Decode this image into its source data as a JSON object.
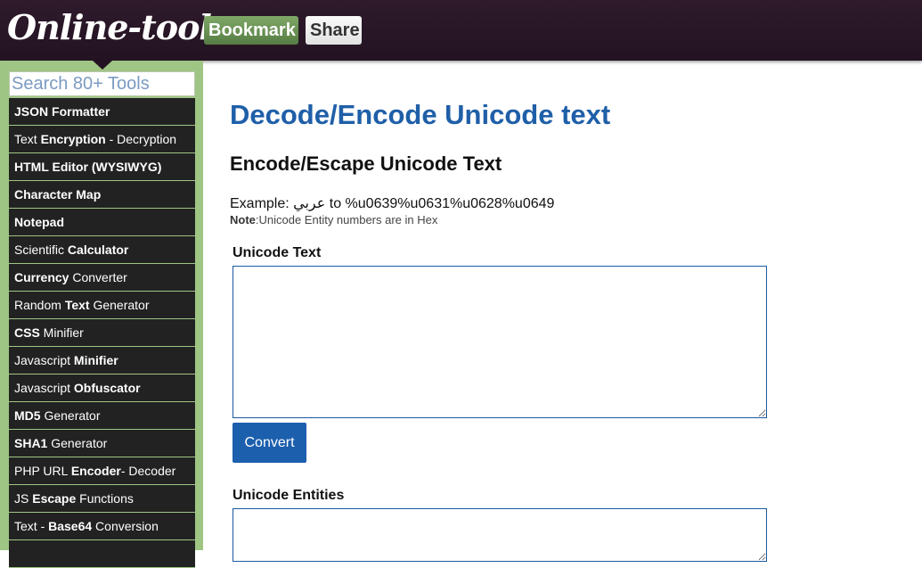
{
  "header": {
    "logo": "Online-toolz",
    "bookmark_label": "Bookmark",
    "share_label": "Share",
    "colors": {
      "background": "#2e1a2b",
      "bookmark": "#6b9556",
      "share": "#eeeeee"
    }
  },
  "sidebar": {
    "search_placeholder": "Search 80+ Tools",
    "items": [
      {
        "pre": "",
        "bold": "JSON Formatter",
        "post": ""
      },
      {
        "pre": "Text ",
        "bold": "Encryption",
        "post": " - Decryption"
      },
      {
        "pre": "",
        "bold": "HTML Editor (WYSIWYG)",
        "post": ""
      },
      {
        "pre": "",
        "bold": "Character Map",
        "post": ""
      },
      {
        "pre": "",
        "bold": "Notepad",
        "post": ""
      },
      {
        "pre": "Scientific ",
        "bold": "Calculator",
        "post": ""
      },
      {
        "pre": "",
        "bold": "Currency",
        "post": " Converter"
      },
      {
        "pre": "Random ",
        "bold": "Text",
        "post": " Generator"
      },
      {
        "pre": "",
        "bold": "CSS",
        "post": " Minifier"
      },
      {
        "pre": "Javascript ",
        "bold": "Minifier",
        "post": ""
      },
      {
        "pre": "Javascript ",
        "bold": "Obfuscator",
        "post": ""
      },
      {
        "pre": "",
        "bold": "MD5",
        "post": " Generator"
      },
      {
        "pre": "",
        "bold": "SHA1",
        "post": " Generator"
      },
      {
        "pre": "PHP URL ",
        "bold": "Encoder",
        "post": "- Decoder"
      },
      {
        "pre": "JS ",
        "bold": "Escape",
        "post": " Functions"
      },
      {
        "pre": "Text - ",
        "bold": "Base64",
        "post": " Conversion"
      },
      {
        "pre": "",
        "bold": "",
        "post": ""
      }
    ],
    "colors": {
      "background": "#9fc584",
      "item": "#222222"
    }
  },
  "main": {
    "title": "Decode/Encode Unicode text",
    "section_title": "Encode/Escape Unicode Text",
    "example_text": "Example: عربي to %u0639%u0631%u0628%u0649",
    "note_label": "Note",
    "note_text": ":Unicode Entity numbers are in Hex",
    "unicode_text_label": "Unicode Text",
    "unicode_text_value": "",
    "convert_label": "Convert",
    "unicode_entities_label": "Unicode Entities",
    "unicode_entities_value": "",
    "colors": {
      "title": "#1f5fa8",
      "button": "#1c5fad"
    }
  }
}
